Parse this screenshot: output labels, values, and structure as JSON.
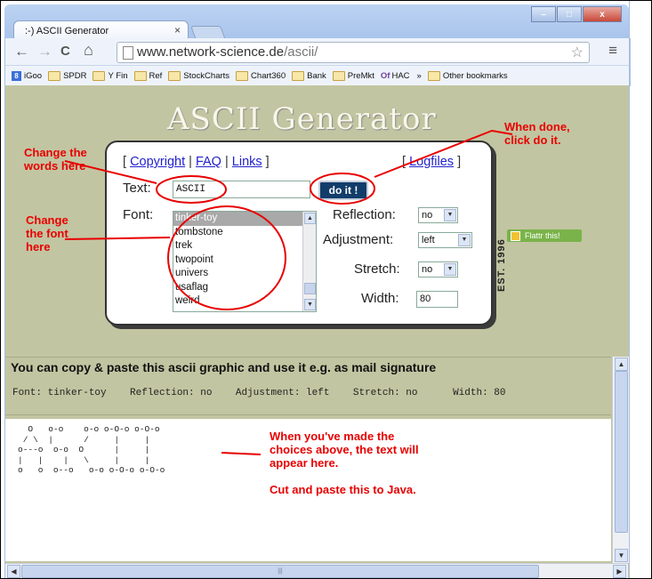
{
  "browser": {
    "tab_title": ":-) ASCII Generator",
    "tab_close": "×",
    "url_host": "www.network-science.de",
    "url_path": "/ascii/",
    "win_min": "–",
    "win_max": "□",
    "win_close": "x",
    "back_glyph": "←",
    "forward_glyph": "→",
    "reload_glyph": "C",
    "home_glyph": "⌂",
    "star_glyph": "☆",
    "menu_glyph": "≡",
    "bookmarks": [
      "iGoo",
      "SPDR",
      "Y Fin",
      "Ref",
      "StockCharts",
      "Chart360",
      "Bank",
      "PreMkt",
      "HAC"
    ],
    "bookmarks_more": "»",
    "other_bookmarks": "Other bookmarks"
  },
  "page": {
    "site_title": "ASCII Generator",
    "links": {
      "copyright": "Copyright",
      "faq": "FAQ",
      "links": "Links",
      "logfiles": "Logfiles"
    },
    "text_label": "Text:",
    "text_value": "ASCII",
    "doit_label": "do it !",
    "font_label": "Font:",
    "font_options": [
      "tinker-toy",
      "tombstone",
      "trek",
      "twopoint",
      "univers",
      "usaflag",
      "weird"
    ],
    "reflection_label": "Reflection:",
    "reflection_value": "no",
    "adjustment_label": "Adjustment:",
    "adjustment_value": "left",
    "stretch_label": "Stretch:",
    "stretch_value": "no",
    "width_label": "Width:",
    "width_value": "80",
    "est_label": "EST. 1996",
    "flattr_label": "Flattr this!",
    "copy_heading": "You can copy & paste this ascii graphic and use it e.g. as mail signature",
    "status_line": "Font: tinker-toy    Reflection: no    Adjustment: left    Stretch: no      Width: 80",
    "ascii_art": "  O   o-o    o-o o-O-o o-O-o\n / \\  |      /     |     |  \no---o  o-o  O      |     |  \n|   |    |   \\     |     |  \no   o  o--o   o-o o-O-o o-O-o"
  },
  "annotations": {
    "change_words": "Change the\nwords here",
    "change_font": "Change\nthe font\nhere",
    "when_done": "When done,\nclick do it.",
    "result_note": "When you've made the\nchoices above, the text will\nappear here.\n\nCut and paste this to Java."
  },
  "colors": {
    "page_bg": "#c2c5a1",
    "annotation_red": "#e80000",
    "doit_bg": "#123d6a"
  }
}
